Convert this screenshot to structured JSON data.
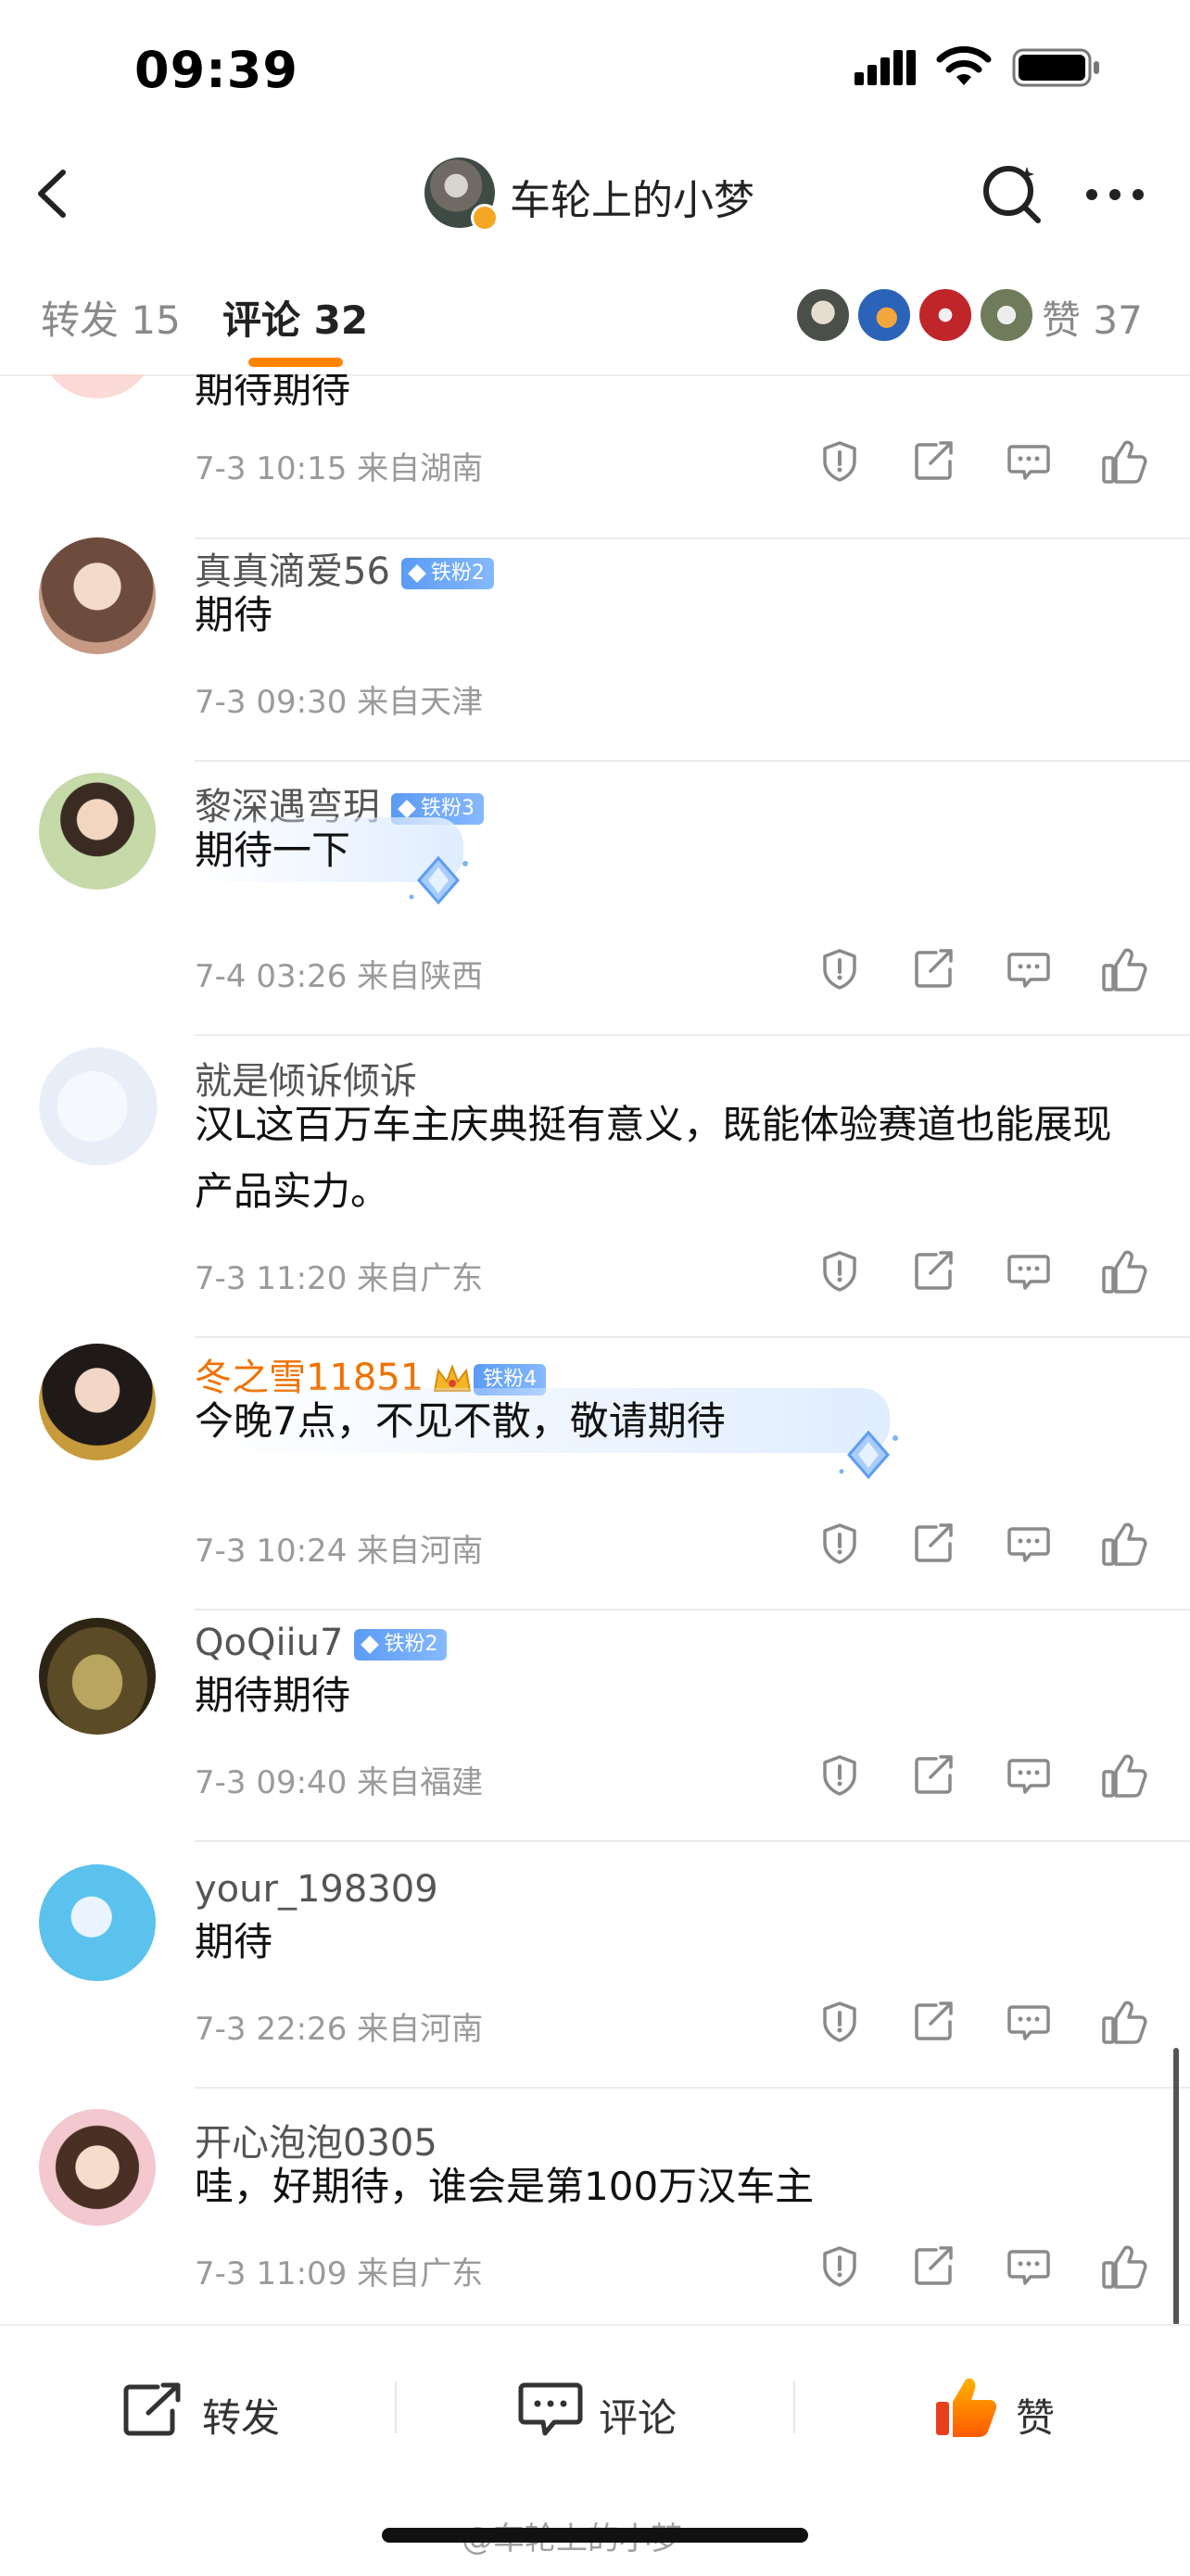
{
  "status_bar": {
    "time": "09:39"
  },
  "header": {
    "title": "车轮上的小梦"
  },
  "tabs": {
    "repost": "转发 15",
    "comment": "评论 32",
    "like": "赞 37"
  },
  "comments": [
    {
      "text": "期待期待",
      "meta": "7-3 10:15 来自湖南"
    },
    {
      "name": "真真滴爱56",
      "fan_badge": "铁粉2",
      "text": "期待",
      "meta": "7-3 09:30 来自天津"
    },
    {
      "name": "黎深遇弯玥",
      "fan_badge": "铁粉3",
      "text": "期待一下",
      "meta": "7-4 03:26 来自陕西"
    },
    {
      "name": "就是倾诉倾诉",
      "text": "汉L这百万车主庆典挺有意义，既能体验赛道也能展现产品实力。",
      "meta": "7-3 11:20 来自广东"
    },
    {
      "name": "冬之雪11851",
      "fan_badge": "铁粉4",
      "text": "今晚7点，不见不散，敬请期待",
      "meta": "7-3 10:24 来自河南"
    },
    {
      "name": "QoQiiu7",
      "fan_badge": "铁粉2",
      "text": "期待期待",
      "meta": "7-3 09:40 来自福建"
    },
    {
      "name": "your_198309",
      "text": "期待",
      "meta": "7-3 22:26 来自河南"
    },
    {
      "name": "开心泡泡0305",
      "text": "哇，好期待，谁会是第100万汉车主",
      "meta": "7-3 11:09 来自广东"
    }
  ],
  "bottom_bar": {
    "repost": "转发",
    "comment": "评论",
    "like": "赞"
  },
  "watermark": "@车轮上的小梦",
  "colors": {
    "accent": "#ff8200",
    "vip_name": "#f07100",
    "fan_badge": "#5b9bf5"
  },
  "icons": [
    "back-icon",
    "search-icon",
    "more-icon",
    "report-icon",
    "share-icon",
    "comment-icon",
    "like-icon"
  ]
}
